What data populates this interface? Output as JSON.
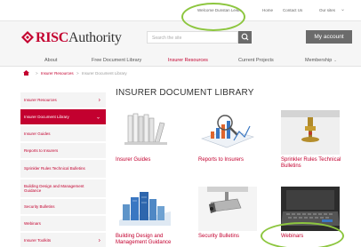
{
  "topbar": {
    "welcome": "Welcome Dunstan Lewis",
    "home": "Home",
    "contact": "Contact Us",
    "our_sites": "Our sites"
  },
  "header": {
    "logo_brand": "RISC",
    "logo_rest": "Authority",
    "search_placeholder": "Search the site",
    "account_button": "My account"
  },
  "nav": {
    "items": [
      {
        "label": "About"
      },
      {
        "label": "Free Document Library"
      },
      {
        "label": "Insurer Resources"
      },
      {
        "label": "Current Projects"
      },
      {
        "label": "Membership"
      }
    ]
  },
  "breadcrumb": {
    "items": [
      "Insurer Resources",
      "Insurer Document Library"
    ]
  },
  "sidebar": {
    "items": [
      {
        "label": "Insurer Resources"
      },
      {
        "label": "Insurer Document Library"
      },
      {
        "label": "Insurer Guides"
      },
      {
        "label": "Reports to Insurers"
      },
      {
        "label": "Sprinkler Rules Technical Bulletins"
      },
      {
        "label": "Building Design and Management Guidance"
      },
      {
        "label": "Security Bulletins"
      },
      {
        "label": "Webinars"
      },
      {
        "label": "Insurer Toolkits"
      }
    ]
  },
  "main": {
    "title": "INSURER DOCUMENT LIBRARY",
    "cards": [
      {
        "label": "Insurer Guides",
        "icon": "books-icon"
      },
      {
        "label": "Reports to Insurers",
        "icon": "analysis-icon"
      },
      {
        "label": "Sprinkler Rules Technical Bulletins",
        "icon": "sprinkler-icon"
      },
      {
        "label": "Building Design and Management Guidance",
        "icon": "buildings-icon"
      },
      {
        "label": "Security Bulletins",
        "icon": "cctv-icon"
      },
      {
        "label": "Webinars",
        "icon": "laptop-icon"
      }
    ]
  },
  "colors": {
    "brand_red": "#c3002f",
    "annotation_green": "#8dc63f",
    "button_grey": "#6b6b6b"
  }
}
